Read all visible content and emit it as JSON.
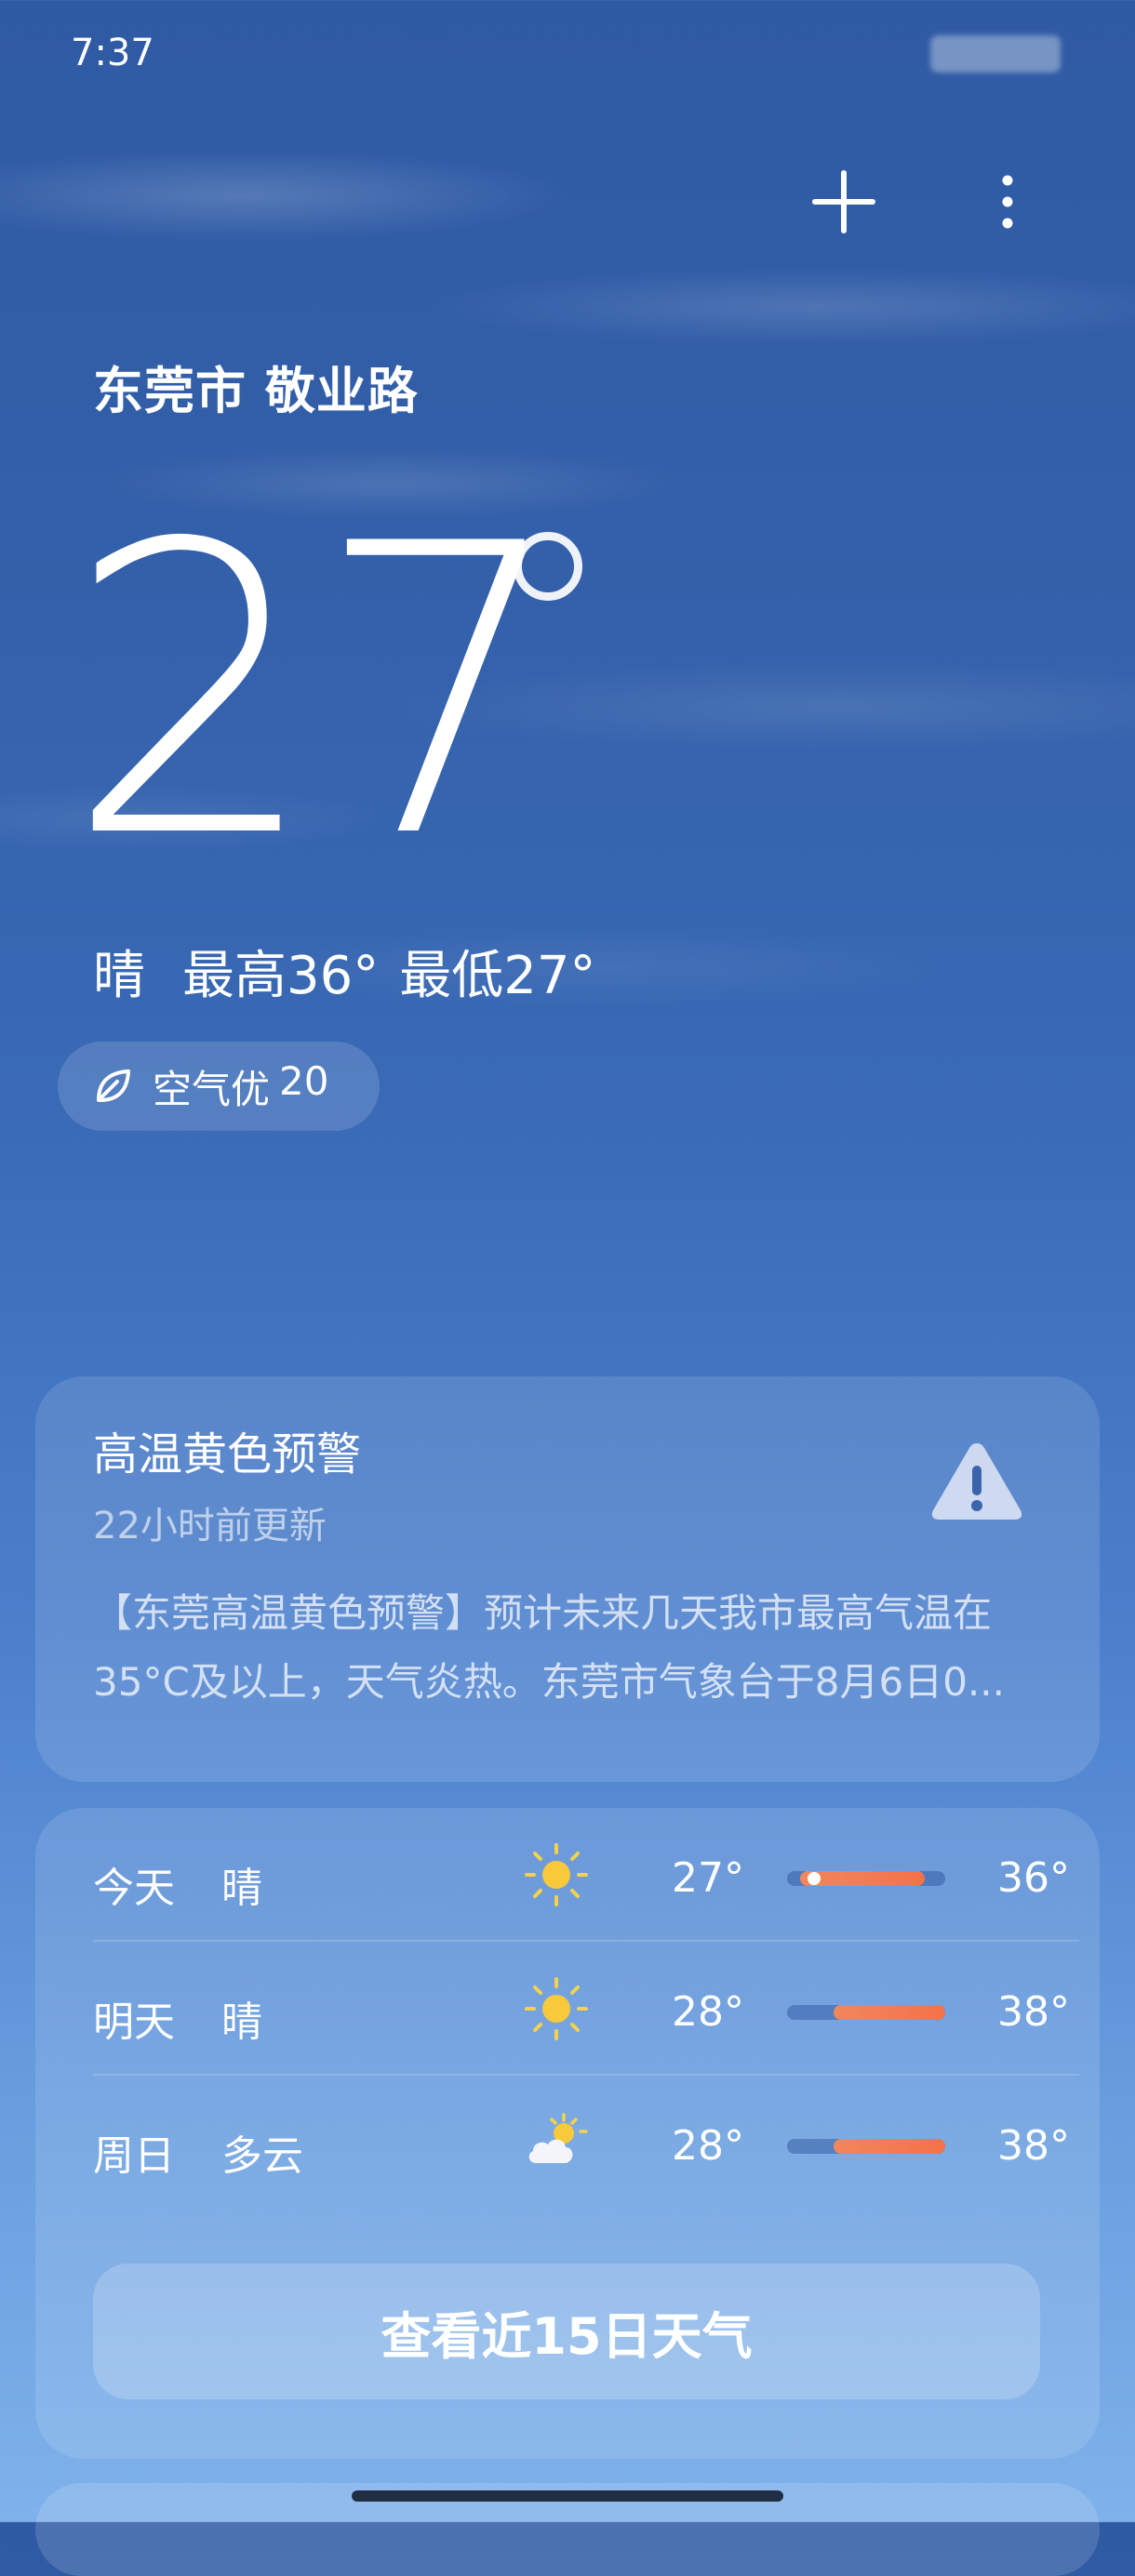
{
  "status_bar": {
    "time": "7:37"
  },
  "header": {
    "location": "东莞市 敬业路"
  },
  "current": {
    "temp": "27",
    "condition": "晴",
    "high": "最高36°",
    "low": "最低27°",
    "air_quality": {
      "label": "空气优",
      "value": "20"
    }
  },
  "alert": {
    "title": "高温黄色预警",
    "updated": "22小时前更新",
    "line1": "【东莞高温黄色预警】预计未来几天我市最高气温在",
    "line2": "35°C及以上，天气炎热。东莞市气象台于8月6日0..."
  },
  "forecast": {
    "rows": [
      {
        "day": "今天",
        "cond": "晴",
        "icon": "sun-icon",
        "low": "27°",
        "high": "36°"
      },
      {
        "day": "明天",
        "cond": "晴",
        "icon": "sun-icon",
        "low": "28°",
        "high": "38°"
      },
      {
        "day": "周日",
        "cond": "多云",
        "icon": "partly-cloudy-icon",
        "low": "28°",
        "high": "38°"
      }
    ],
    "more_label": "查看近15日天气"
  },
  "colors": {
    "bar_fill": "#f47249",
    "bg_top": "#2f5aa4",
    "bg_bottom": "#7fb2ea"
  }
}
